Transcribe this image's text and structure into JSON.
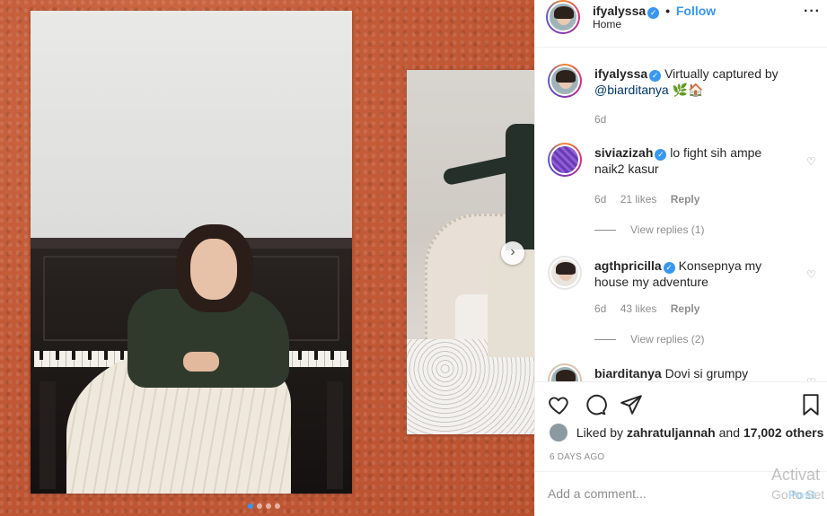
{
  "header": {
    "username": "ifyalyssa",
    "separator": "•",
    "follow_label": "Follow",
    "location": "Home",
    "more_icon": "more-horizontal-icon"
  },
  "caption": {
    "username": "ifyalyssa",
    "text_1": "Virtually captured by",
    "mention": "@biarditanya",
    "emoji": "🌿🏠",
    "age": "6d"
  },
  "comments": [
    {
      "username": "siviazizah",
      "text": "lo fight sih ampe naik2 kasur",
      "age": "6d",
      "likes": "21 likes",
      "reply": "Reply",
      "view_replies": "View replies (1)"
    },
    {
      "username": "agthpricilla",
      "text": "Konsepnya my house my adventure",
      "age": "6d",
      "likes": "43 likes",
      "reply": "Reply",
      "view_replies": "View replies (2)"
    },
    {
      "username": "biarditanya",
      "text": "Dovi si grumpy"
    }
  ],
  "likes": {
    "prefix": "Liked by",
    "user": "zahratuljannah",
    "and": "and",
    "others": "17,002 others"
  },
  "timestamp": "6 DAYS AGO",
  "add_comment": {
    "placeholder": "Add a comment...",
    "post_label": "Post"
  },
  "watermark": {
    "line1": "Activat",
    "line2": "Go to Set"
  },
  "carousel": {
    "next_icon": "chevron-right-icon",
    "total": 4,
    "active": 1
  },
  "colors": {
    "accent": "#3897f0",
    "background_orange": "#c35a37"
  }
}
